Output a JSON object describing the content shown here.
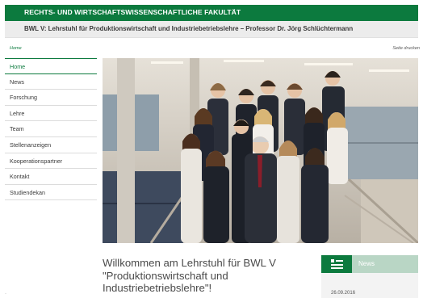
{
  "header": {
    "faculty": "RECHTS- UND WIRTSCHAFTSWISSENSCHAFTLICHE FAKULTÄT",
    "chair": "BWL V: Lehrstuhl für Produktionswirtschaft und Industriebetriebslehre – Professor Dr. Jörg Schlüchtermann"
  },
  "breadcrumb": {
    "home": "Home"
  },
  "tools": {
    "print": "Seite drucken"
  },
  "sidebar": {
    "items": [
      {
        "label": "Home",
        "active": true
      },
      {
        "label": "News"
      },
      {
        "label": "Forschung"
      },
      {
        "label": "Lehre"
      },
      {
        "label": "Team"
      },
      {
        "label": "Stellenanzeigen"
      },
      {
        "label": "Kooperationspartner"
      },
      {
        "label": "Kontakt"
      },
      {
        "label": "Studiendekan"
      }
    ]
  },
  "hero": {
    "icon": "team-photo"
  },
  "main": {
    "welcome_line1": "Willkommen am Lehrstuhl für BWL V",
    "welcome_line2": "\"Produktionswirtschaft und",
    "welcome_line3": "Industriebetriebslehre\"!"
  },
  "news": {
    "title": "News",
    "date": "26.09.2016",
    "icon": "news-icon"
  },
  "colors": {
    "brand": "#0c7a3e",
    "band": "#ececec",
    "news_head": "#b9d6c5"
  }
}
